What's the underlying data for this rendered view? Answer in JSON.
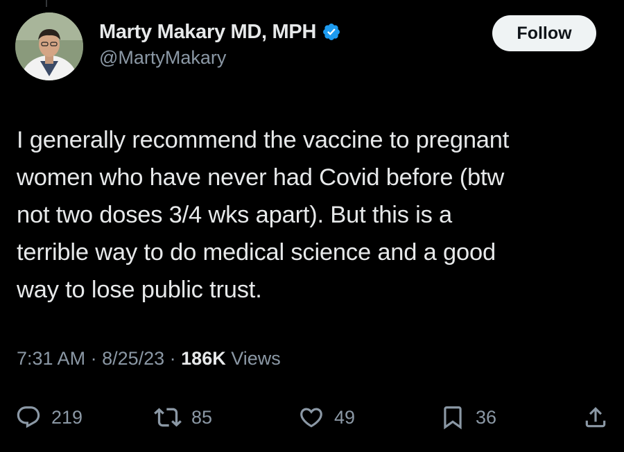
{
  "author": {
    "display_name": "Marty Makary MD, MPH",
    "handle": "@MartyMakary",
    "verified": true
  },
  "follow_label": "Follow",
  "tweet": {
    "lines": [
      "I generally recommend the vaccine to pregnant",
      "women who have never had Covid before (btw",
      "not two doses 3/4 wks apart). But this is a",
      "terrible way to do medical science and a good",
      "way to lose public trust."
    ]
  },
  "meta": {
    "time": "7:31 AM",
    "sep1": " · ",
    "date": "8/25/23",
    "sep2": " · ",
    "views_count": "186K",
    "views_label": " Views"
  },
  "actions": {
    "reply_count": "219",
    "retweet_count": "85",
    "like_count": "49",
    "bookmark_count": "36"
  },
  "icons": {
    "verified": "verified-badge-icon",
    "reply": "speech-bubble-icon",
    "retweet": "retweet-arrows-icon",
    "like": "heart-icon",
    "bookmark": "bookmark-icon",
    "share": "share-arrow-icon"
  },
  "colors": {
    "background": "#000000",
    "text": "#e7e9ea",
    "secondary_text": "#8b98a5",
    "verified_blue": "#1d9bf0",
    "follow_bg": "#eff3f4"
  }
}
